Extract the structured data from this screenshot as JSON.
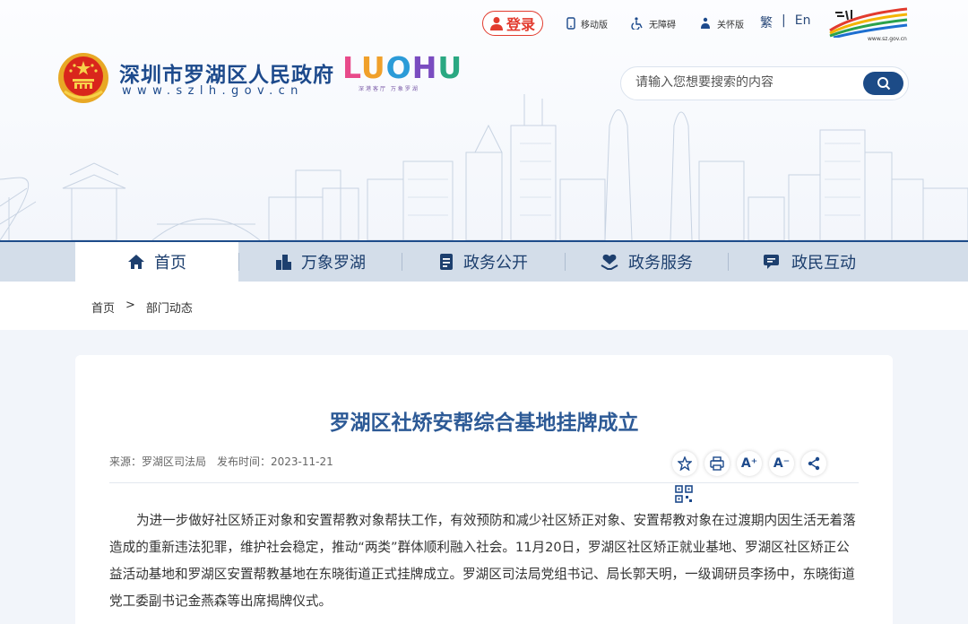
{
  "topbar": {
    "login_label": "登录",
    "links": [
      {
        "label": "移动版",
        "icon": "mobile-icon"
      },
      {
        "label": "无障碍",
        "icon": "accessibility-icon"
      },
      {
        "label": "关怀版",
        "icon": "care-icon"
      }
    ],
    "lang_trad": "繁",
    "lang_sep": "|",
    "lang_en": "En",
    "shenzhen_logo_url": "www.sz.gov.cn"
  },
  "header": {
    "site_name": "深圳市罗湖区人民政府",
    "site_url": "www.szlh.gov.cn",
    "brand_word": "LUOHU",
    "brand_slogan": "深港客厅 万象罗湖"
  },
  "search": {
    "placeholder": "请输入您想要搜索的内容"
  },
  "nav": {
    "items": [
      {
        "label": "首页",
        "icon": "home-icon"
      },
      {
        "label": "万象罗湖",
        "icon": "buildings-icon"
      },
      {
        "label": "政务公开",
        "icon": "document-icon"
      },
      {
        "label": "政务服务",
        "icon": "service-icon"
      },
      {
        "label": "政民互动",
        "icon": "chat-icon"
      }
    ]
  },
  "breadcrumb": {
    "home": "首页",
    "sep": ">",
    "current": "部门动态"
  },
  "article": {
    "title": "罗湖区社矫安帮综合基地挂牌成立",
    "source": "来源：罗湖区司法局",
    "date": "发布时间：2023-11-21",
    "body": "为进一步做好社区矫正对象和安置帮教对象帮扶工作，有效预防和减少社区矫正对象、安置帮教对象在过渡期内因生活无着落造成的重新违法犯罪，维护社会稳定，推动“两类”群体顺利融入社会。11月20日，罗湖区社区矫正就业基地、罗湖区社区矫正公益活动基地和罗湖区安置帮教基地在东晓街道正式挂牌成立。罗湖区司法局党组书记、局长郭天明，一级调研员李扬中，东晓街道党工委副书记金燕森等出席揭牌仪式。",
    "tools": [
      {
        "label": "☆",
        "icon": "star-icon"
      },
      {
        "label": "⎙",
        "icon": "print-icon"
      },
      {
        "label": "A⁺",
        "icon": "font-increase-icon"
      },
      {
        "label": "A⁻",
        "icon": "font-decrease-icon"
      },
      {
        "label": "⋖",
        "icon": "share-icon"
      }
    ]
  },
  "colors": {
    "primary": "#1d4a8c",
    "accent_red": "#e23b2e",
    "nav_bg": "#d3dde9",
    "title": "#2d5a96"
  }
}
